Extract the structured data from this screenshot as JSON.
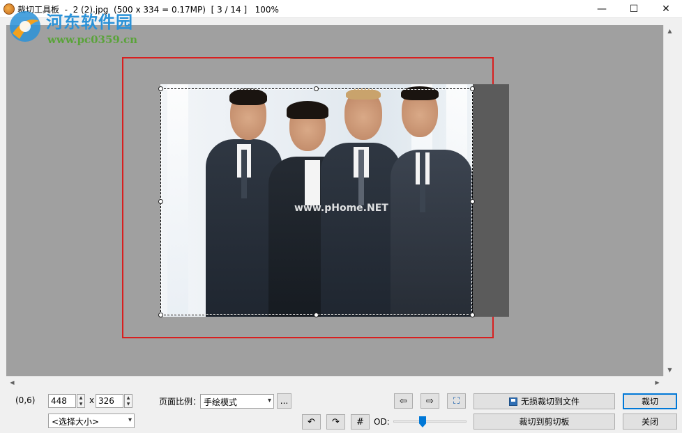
{
  "window": {
    "title": "裁切工具板  -  2 (2).jpg  (500 x 334 = 0.17MP)  [ 3 / 14 ]   100%",
    "minimize": "—",
    "maximize": "☐",
    "close": "✕"
  },
  "watermark": {
    "title": "河东软件园",
    "url": "www.pc0359.cn"
  },
  "photo": {
    "overlay_text": "www.pHome.NET"
  },
  "status": {
    "coord": "(0,6)"
  },
  "size": {
    "width": "448",
    "height": "326",
    "x_label": "x",
    "preset_placeholder": "<选择大小>"
  },
  "ratio": {
    "label": "页面比例：",
    "value": "手绘模式",
    "more": "..."
  },
  "nav": {
    "prev": "⇦",
    "next": "⇨",
    "fit": "⛶"
  },
  "tools": {
    "rotate_left": "↶",
    "rotate_right": "↷",
    "grid": "#",
    "od_label": "OD:"
  },
  "od_slider": {
    "value_fraction": 0.4
  },
  "actions": {
    "lossless_crop": "无损裁切到文件",
    "crop_clipboard": "裁切到剪切板",
    "crop": "裁切",
    "close": "关闭"
  },
  "colors": {
    "crop_border": "#d81f1f",
    "canvas_bg": "#a0a0a0",
    "accent": "#0078d7"
  }
}
